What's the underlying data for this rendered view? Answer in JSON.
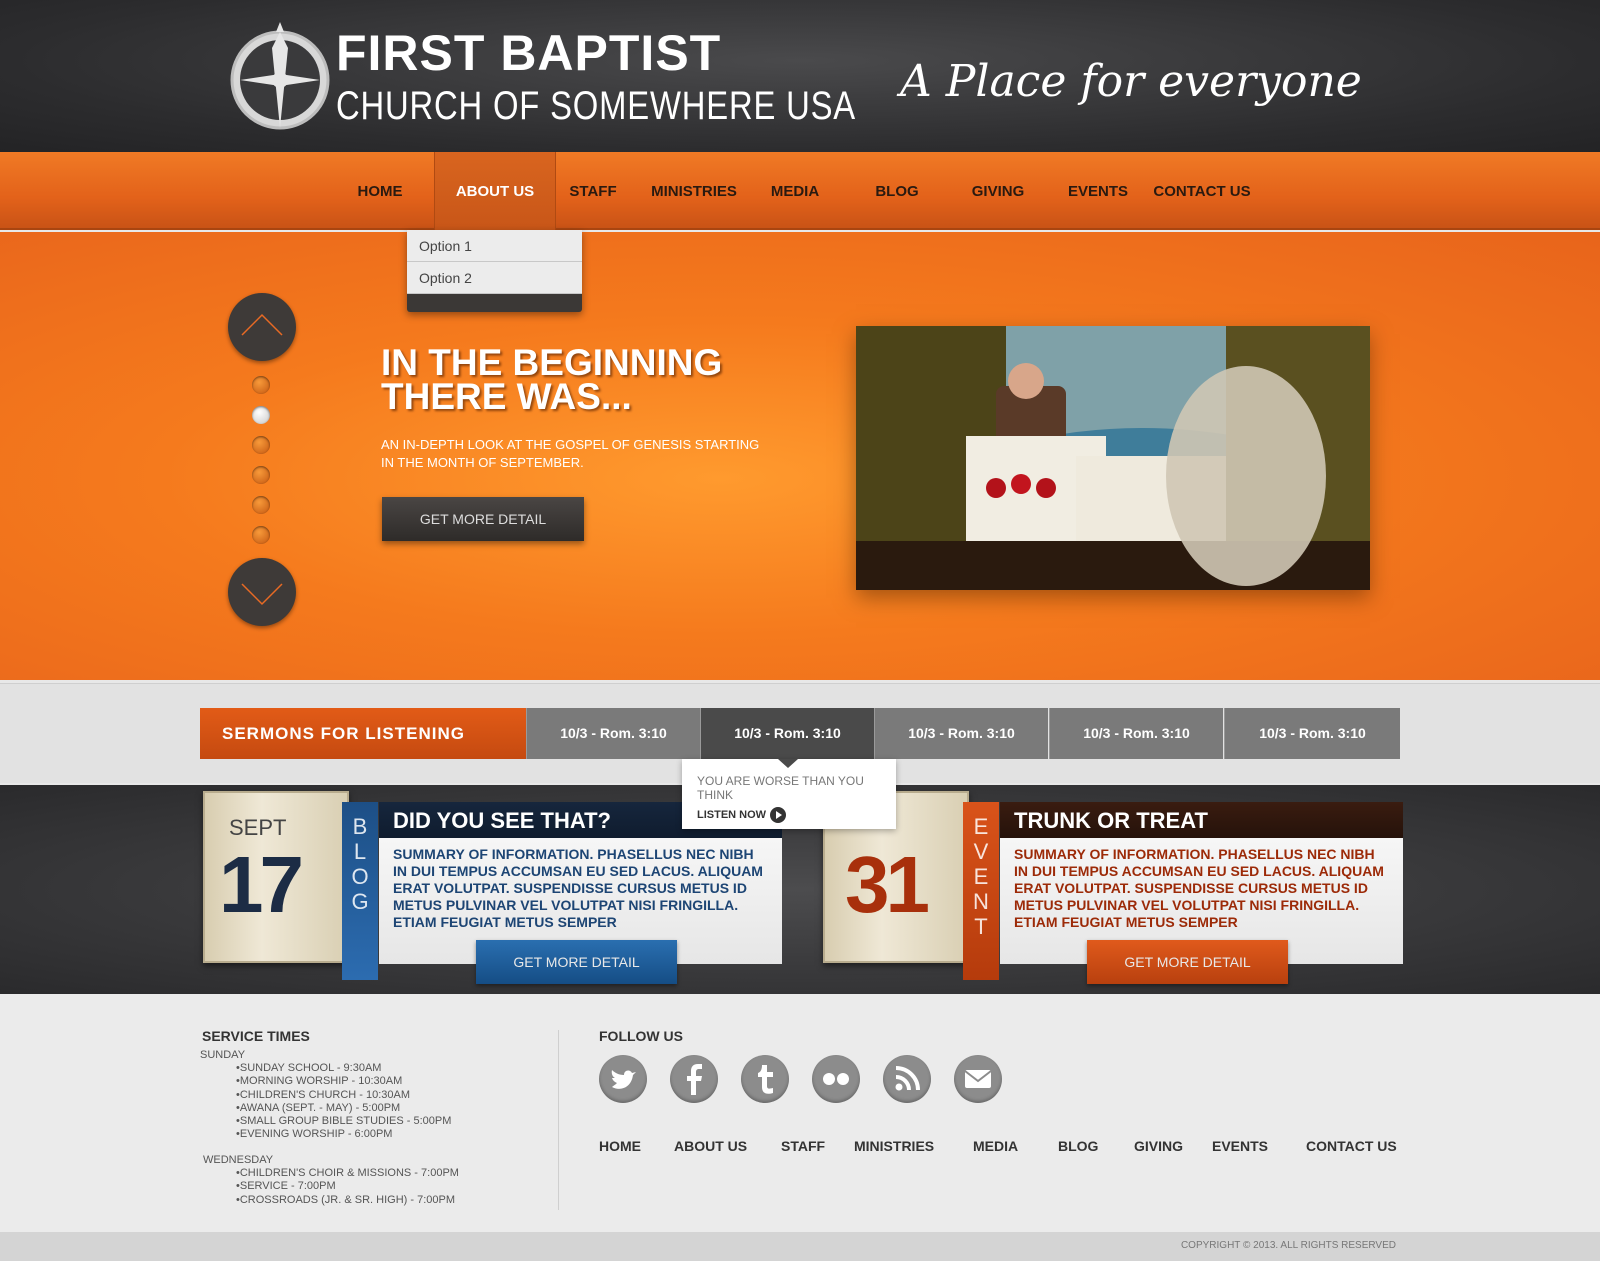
{
  "header": {
    "brand_line1": "FIRST BAPTIST",
    "brand_line2": "CHURCH OF SOMEWHERE USA",
    "tagline": "A Place for everyone"
  },
  "nav": {
    "items": [
      "HOME",
      "ABOUT US",
      "STAFF",
      "MINISTRIES",
      "MEDIA",
      "BLOG",
      "GIVING",
      "EVENTS",
      "CONTACT US"
    ],
    "active": "ABOUT US"
  },
  "dropdown": {
    "options": [
      "Option 1",
      "Option 2"
    ]
  },
  "hero": {
    "title": "IN THE BEGINNING THERE WAS...",
    "subtitle": "AN IN-DEPTH LOOK AT THE GOSPEL OF GENESIS STARTING IN THE MONTH OF SEPTEMBER.",
    "button": "GET MORE DETAIL",
    "slide_count": 6,
    "active_slide": 2
  },
  "sermons": {
    "label": "SERMONS FOR LISTENING",
    "tabs": [
      "10/3 - Rom. 3:10",
      "10/3 - Rom. 3:10",
      "10/3 - Rom. 3:10",
      "10/3 - Rom. 3:10",
      "10/3 - Rom. 3:10"
    ],
    "active_tab": 2,
    "tooltip": {
      "text": "YOU ARE WORSE THAN YOU THINK",
      "action": "LISTEN NOW"
    }
  },
  "features": [
    {
      "month": "SEPT",
      "day": "17",
      "ribbon": "BLOG",
      "title": "DID YOU SEE THAT?",
      "summary": "SUMMARY OF INFORMATION.  PHASELLUS NEC NIBH IN DUI TEMPUS ACCUMSAN EU SED LACUS. ALIQUAM ERAT VOLUTPAT. SUSPENDISSE CURSUS METUS ID METUS PULVINAR VEL VOLUTPAT NISI FRINGILLA. ETIAM FEUGIAT METUS SEMPER",
      "button": "GET MORE DETAIL",
      "accent": "#1f5e9a"
    },
    {
      "month": "",
      "day": "31",
      "ribbon": "EVENT",
      "title": "TRUNK OR TREAT",
      "summary": "SUMMARY OF INFORMATION.  PHASELLUS NEC NIBH IN DUI TEMPUS ACCUMSAN EU SED LACUS. ALIQUAM ERAT VOLUTPAT. SUSPENDISSE CURSUS METUS ID METUS PULVINAR VEL VOLUTPAT NISI FRINGILLA. ETIAM FEUGIAT METUS SEMPER",
      "button": "GET MORE DETAIL",
      "accent": "#c5400f"
    }
  ],
  "footer": {
    "service_heading": "SERVICE TIMES",
    "sunday_label": "SUNDAY",
    "sunday": [
      "•SUNDAY SCHOOL - 9:30AM",
      "•MORNING WORSHIP - 10:30AM",
      "•CHILDREN'S CHURCH - 10:30AM",
      "•AWANA (SEPT. - MAY)  - 5:00PM",
      "•SMALL GROUP BIBLE STUDIES -  5:00PM",
      "•EVENING WORSHIP - 6:00PM"
    ],
    "wednesday_label": "WEDNESDAY",
    "wednesday": [
      "•CHILDREN'S CHOIR & MISSIONS - 7:00PM",
      "•SERVICE   - 7:00PM",
      "•CROSSROADS (JR. & SR. HIGH) - 7:00PM"
    ],
    "follow_heading": "FOLLOW US",
    "social": [
      "twitter-icon",
      "facebook-icon",
      "tumblr-icon",
      "flickr-icon",
      "rss-icon",
      "email-icon"
    ],
    "nav": [
      "HOME",
      "ABOUT US",
      "STAFF",
      "MINISTRIES",
      "MEDIA",
      "BLOG",
      "GIVING",
      "EVENTS",
      "CONTACT US"
    ],
    "copyright": "COPYRIGHT © 2013. ALL RIGHTS RESERVED"
  },
  "colors": {
    "brand_orange": "#e8641b",
    "dark_gray": "#2e2b29",
    "blog_blue": "#1f5e9a",
    "event_red": "#c5400f"
  }
}
